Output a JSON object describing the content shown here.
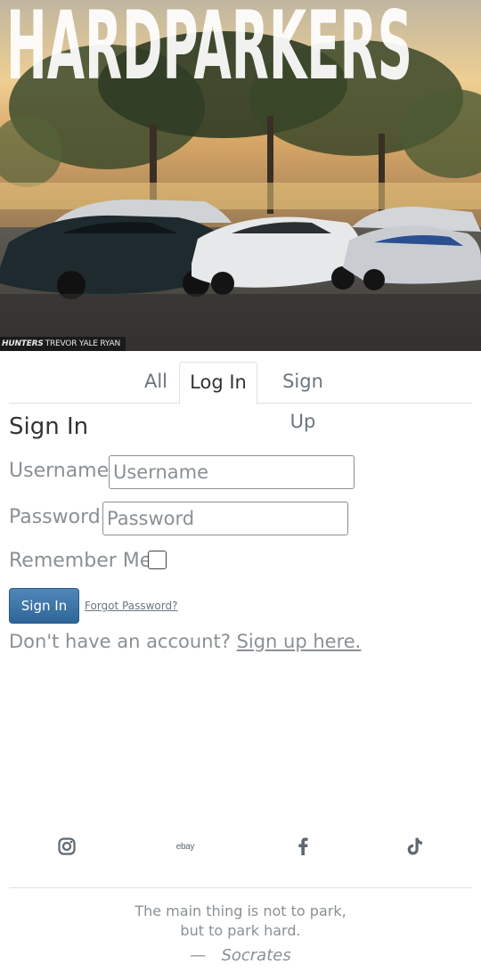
{
  "banner": {
    "title": "HARDPARKERS",
    "credit_brand": "HUNTERS",
    "credit_name": "TREVOR YALE RYAN"
  },
  "tabs": [
    {
      "label": "All",
      "active": false
    },
    {
      "label": "Log In",
      "active": true
    },
    {
      "label": "Sign Up",
      "active": false
    }
  ],
  "form": {
    "title": "Sign In",
    "username_label": "Username:",
    "username_placeholder": "Username",
    "username_value": "",
    "password_label": "Password:",
    "password_placeholder": "Password",
    "password_value": "",
    "remember_label": "Remember Me:",
    "remember_checked": false,
    "submit_label": "Sign In",
    "forgot_label": "Forgot Password?"
  },
  "signup_prompt": {
    "text": "Don't have an account? ",
    "link": "Sign up here."
  },
  "social": [
    {
      "icon": "instagram-icon"
    },
    {
      "icon": "ebay-icon",
      "label": "ebay"
    },
    {
      "icon": "facebook-icon"
    },
    {
      "icon": "tiktok-icon"
    }
  ],
  "quote": {
    "line1": "The main thing is not to park,",
    "line2": "but to park hard.",
    "dash": "—",
    "author": "Socrates"
  },
  "colors": {
    "accent": "#2f6699",
    "muted_text": "#8a9094",
    "icon": "#5f6770"
  }
}
